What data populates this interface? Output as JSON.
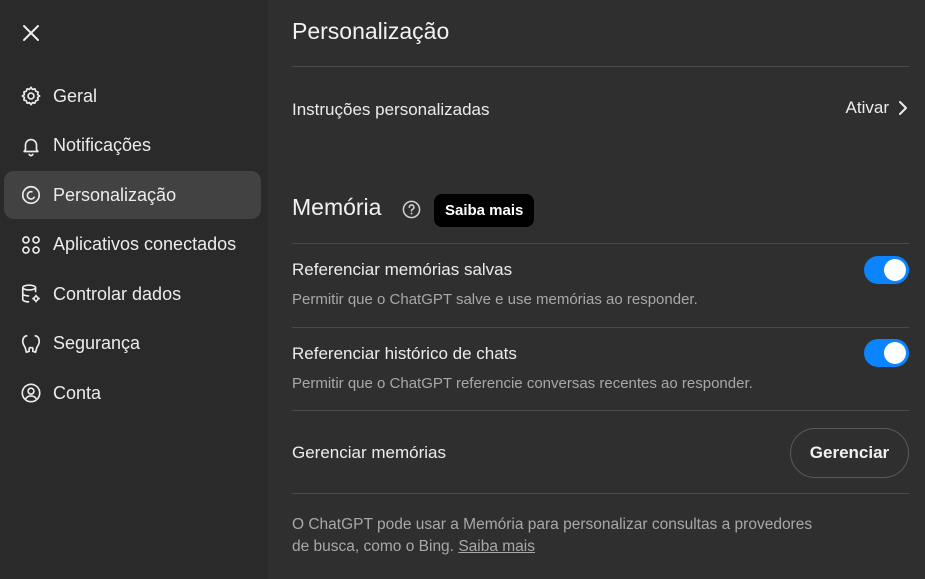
{
  "sidebar": {
    "close_icon": "close-icon",
    "items": [
      {
        "label": "Geral",
        "icon": "gear-icon",
        "active": false
      },
      {
        "label": "Notificações",
        "icon": "bell-icon",
        "active": false
      },
      {
        "label": "Personalização",
        "icon": "personalization-icon",
        "active": true
      },
      {
        "label": "Aplicativos conectados",
        "icon": "apps-icon",
        "active": false
      },
      {
        "label": "Controlar dados",
        "icon": "database-icon",
        "active": false
      },
      {
        "label": "Segurança",
        "icon": "security-icon",
        "active": false
      },
      {
        "label": "Conta",
        "icon": "account-icon",
        "active": false
      }
    ]
  },
  "main": {
    "title": "Personalização",
    "custom_instructions": {
      "label": "Instruções personalizadas",
      "action": "Ativar"
    },
    "memory": {
      "title": "Memória",
      "learn_more": "Saiba mais",
      "saved_memories": {
        "label": "Referenciar memórias salvas",
        "description": "Permitir que o ChatGPT salve e use memórias ao responder.",
        "enabled": true
      },
      "chat_history": {
        "label": "Referenciar histórico de chats",
        "description": "Permitir que o ChatGPT referencie conversas recentes ao responder.",
        "enabled": true
      },
      "manage": {
        "label": "Gerenciar memórias",
        "button": "Gerenciar"
      },
      "footer_line1": "O ChatGPT pode usar a Memória para personalizar consultas a provedores",
      "footer_line2": "de busca, como o Bing.",
      "footer_link": "Saiba mais"
    }
  },
  "colors": {
    "background": "#2f2f2f",
    "sidebar": "#2a2a2a",
    "active_item": "#424242",
    "toggle_on": "#0a84ff"
  }
}
